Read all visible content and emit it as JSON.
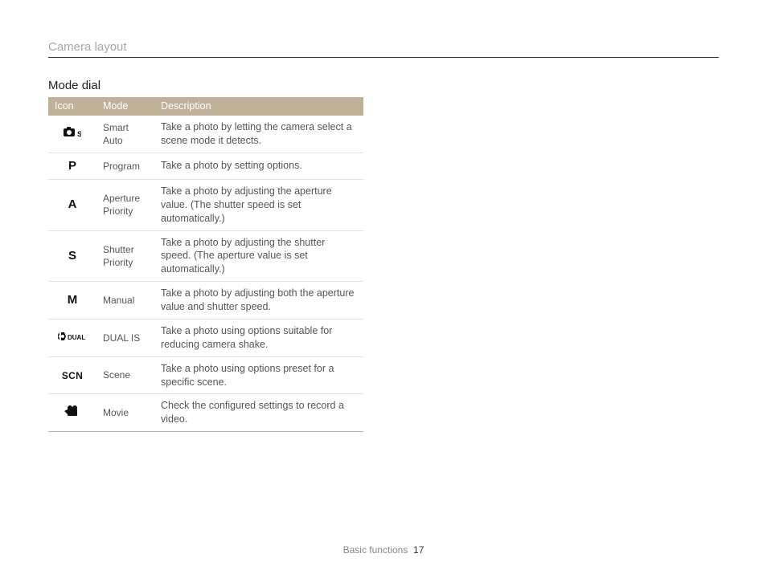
{
  "breadcrumb": "Camera layout",
  "section_title": "Mode dial",
  "table": {
    "headers": {
      "icon": "Icon",
      "mode": "Mode",
      "desc": "Description"
    },
    "rows": [
      {
        "icon_type": "svg-smart",
        "icon_text": "",
        "mode": "Smart Auto",
        "desc": "Take a photo by letting the camera select a scene mode it detects."
      },
      {
        "icon_type": "letter",
        "icon_text": "P",
        "mode": "Program",
        "desc": "Take a photo by setting options."
      },
      {
        "icon_type": "letter",
        "icon_text": "A",
        "mode": "Aperture Priority",
        "desc": "Take a photo by adjusting the aperture value. (The shutter speed is set automatically.)"
      },
      {
        "icon_type": "letter",
        "icon_text": "S",
        "mode": "Shutter Priority",
        "desc": "Take a photo by adjusting the shutter speed. (The aperture value is set automatically.)"
      },
      {
        "icon_type": "letter",
        "icon_text": "M",
        "mode": "Manual",
        "desc": "Take a photo by adjusting both the aperture value and shutter speed."
      },
      {
        "icon_type": "svg-dual",
        "icon_text": "DUAL",
        "mode": "DUAL IS",
        "desc": "Take a photo using options suitable for reducing camera shake."
      },
      {
        "icon_type": "text",
        "icon_text": "SCN",
        "mode": "Scene",
        "desc": "Take a photo using options preset for a specific scene."
      },
      {
        "icon_type": "svg-movie",
        "icon_text": "",
        "mode": "Movie",
        "desc": "Check the configured settings to record a video."
      }
    ]
  },
  "footer": {
    "section": "Basic functions",
    "page": "17"
  }
}
